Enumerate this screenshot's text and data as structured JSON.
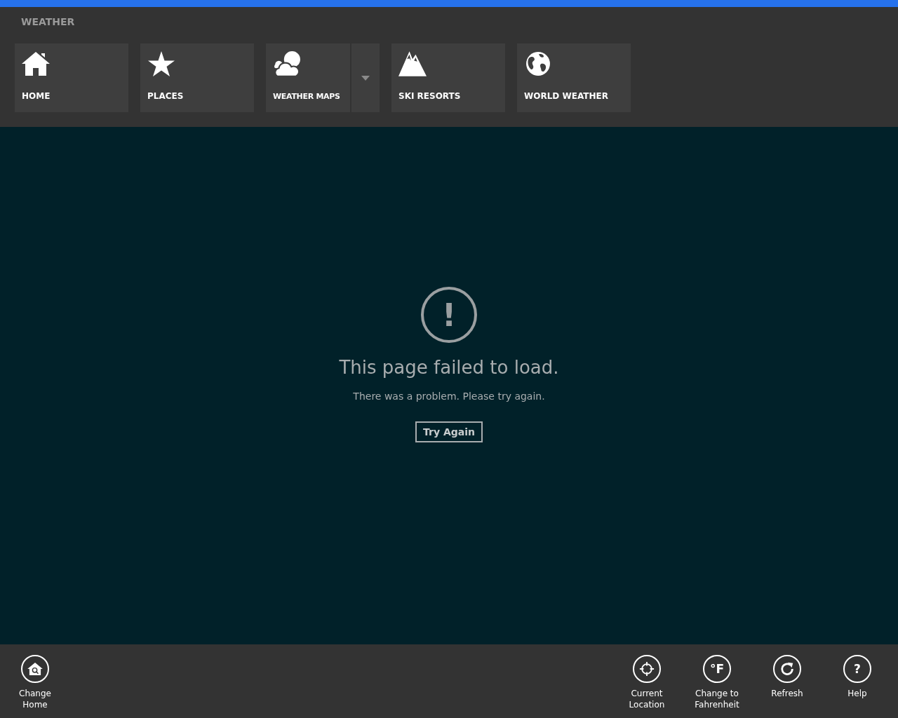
{
  "app_title": "WEATHER",
  "nav_tiles": [
    {
      "label": "HOME",
      "kind": "home",
      "has_dropdown": false
    },
    {
      "label": "PLACES",
      "kind": "star",
      "has_dropdown": false
    },
    {
      "label": "WEATHER MAPS",
      "kind": "clouds",
      "has_dropdown": true
    },
    {
      "label": "SKI RESORTS",
      "kind": "mountains",
      "has_dropdown": false
    },
    {
      "label": "WORLD WEATHER",
      "kind": "globe",
      "has_dropdown": false
    }
  ],
  "error": {
    "icon_glyph": "!",
    "title": "This page failed to load.",
    "message": "There was a problem. Please try again.",
    "button": "Try Again"
  },
  "app_bar": {
    "left": [
      {
        "label": "Change Home",
        "kind": "home-search"
      }
    ],
    "right": [
      {
        "label": "Current Location",
        "kind": "crosshair"
      },
      {
        "label": "Change to Fahrenheit",
        "kind": "glyph",
        "glyph": "°F"
      },
      {
        "label": "Refresh",
        "kind": "refresh"
      },
      {
        "label": "Help",
        "kind": "glyph",
        "glyph": "?"
      }
    ]
  }
}
